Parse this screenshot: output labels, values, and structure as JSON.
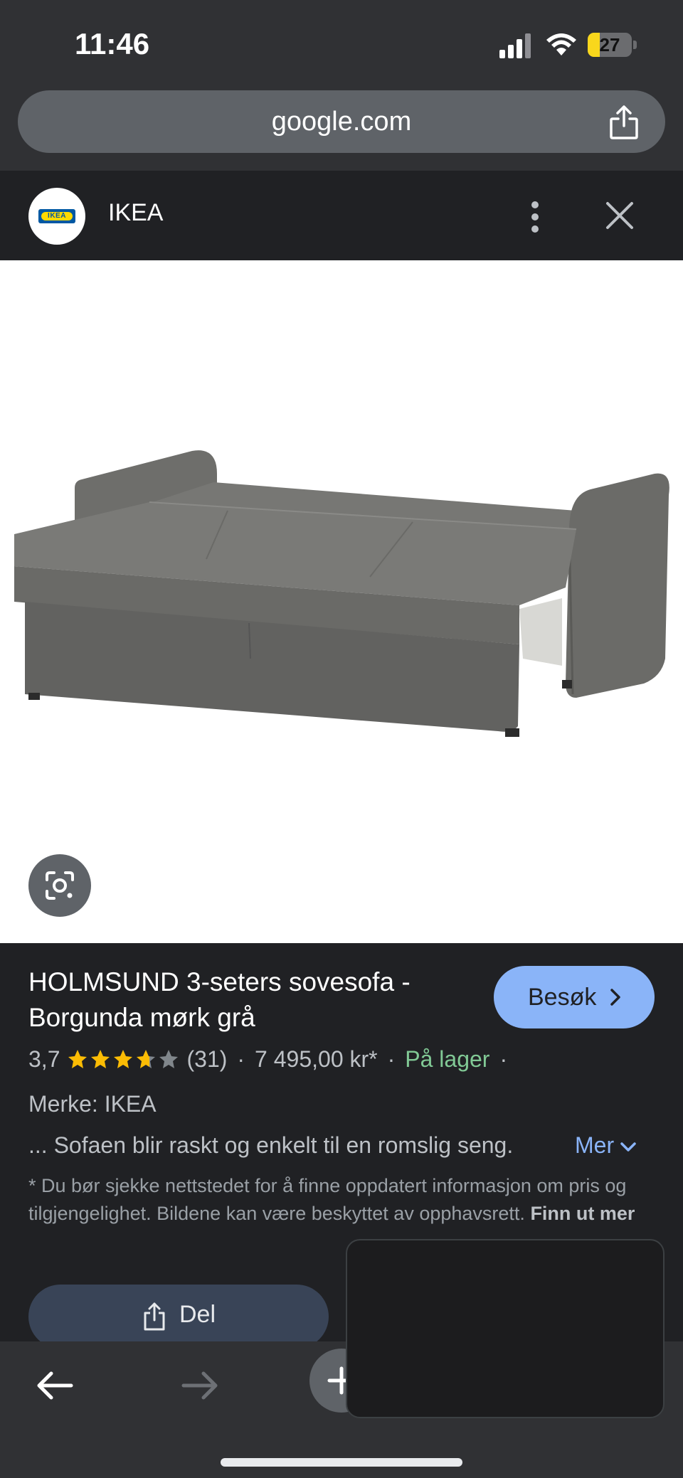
{
  "status_bar": {
    "time": "11:46",
    "battery_level": "27",
    "battery_fraction": 0.27
  },
  "url_bar": {
    "url": "google.com"
  },
  "site_bar": {
    "site_name": "IKEA",
    "logo_text": "IKEA"
  },
  "product": {
    "title": "HOLMSUND 3-seters sovesofa - Borgunda mørk grå",
    "visit_label": "Besøk",
    "rating_value": "3,7",
    "rating_stars": 3.7,
    "review_count": "(31)",
    "separator": "·",
    "price": "7 495,00 kr*",
    "stock": "På lager",
    "brand": "Merke: IKEA",
    "description": "... Sofaen blir raskt og enkelt til en romslig seng.",
    "more_label": "Mer",
    "disclaimer": "* Du bør sjekke nettstedet for å finne oppdatert informasjon om pris og tilgjengelighet. Bildene kan være beskyttet av opphavsrett.",
    "learn_more": "Finn ut mer",
    "share_label": "Del"
  },
  "colors": {
    "accent_blue": "#8ab4f8",
    "stock_green": "#81c995",
    "star_gold": "#fbbc04",
    "background": "#202124"
  },
  "icons": [
    "signal-icon",
    "wifi-icon",
    "battery-icon",
    "share-icon",
    "ikea-logo",
    "more-vert-icon",
    "close-icon",
    "google-lens-icon",
    "chevron-right-icon",
    "star-icon",
    "chevron-down-icon",
    "back-arrow-icon",
    "forward-arrow-icon",
    "new-tab-plus-icon"
  ]
}
